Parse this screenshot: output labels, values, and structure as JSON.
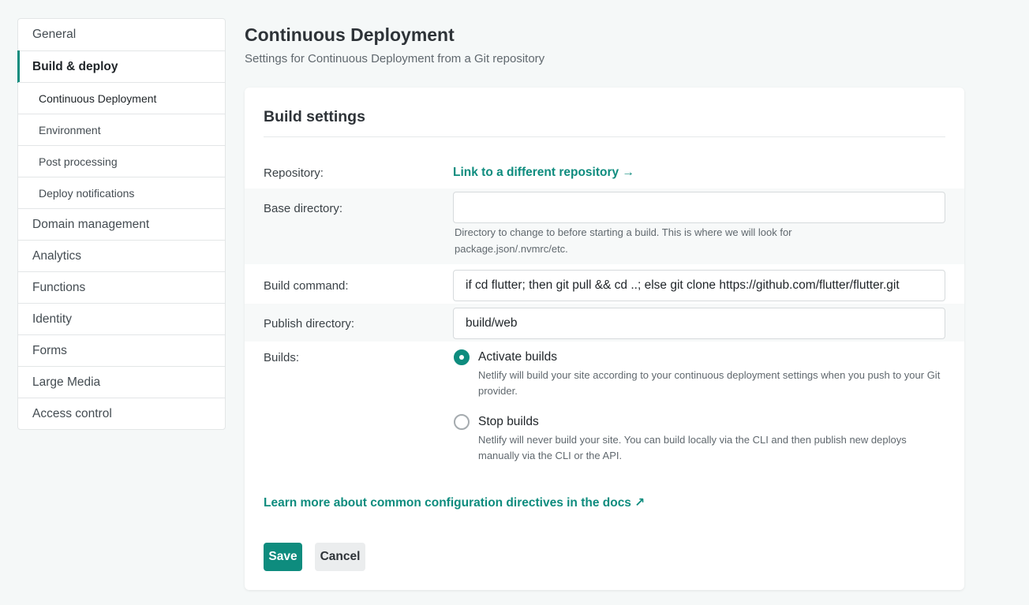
{
  "sidebar": {
    "items": [
      {
        "label": "General"
      },
      {
        "label": "Build & deploy"
      },
      {
        "label": "Continuous Deployment"
      },
      {
        "label": "Environment"
      },
      {
        "label": "Post processing"
      },
      {
        "label": "Deploy notifications"
      },
      {
        "label": "Domain management"
      },
      {
        "label": "Analytics"
      },
      {
        "label": "Functions"
      },
      {
        "label": "Identity"
      },
      {
        "label": "Forms"
      },
      {
        "label": "Large Media"
      },
      {
        "label": "Access control"
      }
    ]
  },
  "header": {
    "title": "Continuous Deployment",
    "subtitle": "Settings for Continuous Deployment from a Git repository"
  },
  "card": {
    "title": "Build settings",
    "repository": {
      "label": "Repository:",
      "link": "Link to a different repository →"
    },
    "base_directory": {
      "label": "Base directory:",
      "value": "",
      "help": "Directory to change to before starting a build. This is where we will look for package.json/.nvmrc/etc."
    },
    "build_command": {
      "label": "Build command:",
      "value": "if cd flutter; then git pull && cd ..; else git clone https://github.com/flutter/flutter.git"
    },
    "publish_directory": {
      "label": "Publish directory:",
      "value": "build/web"
    },
    "builds": {
      "label": "Builds:",
      "activate": {
        "label": "Activate builds",
        "help": "Netlify will build your site according to your continuous deployment settings when you push to your Git provider.",
        "checked": true
      },
      "stop": {
        "label": "Stop builds",
        "help": "Netlify will never build your site. You can build locally via the CLI and then publish new deploys manually via the CLI or the API.",
        "checked": false
      }
    },
    "docs_link": "Learn more about common configuration directives in the docs ↗",
    "save_label": "Save",
    "cancel_label": "Cancel"
  },
  "colors": {
    "accent": "#0e8c7e"
  }
}
